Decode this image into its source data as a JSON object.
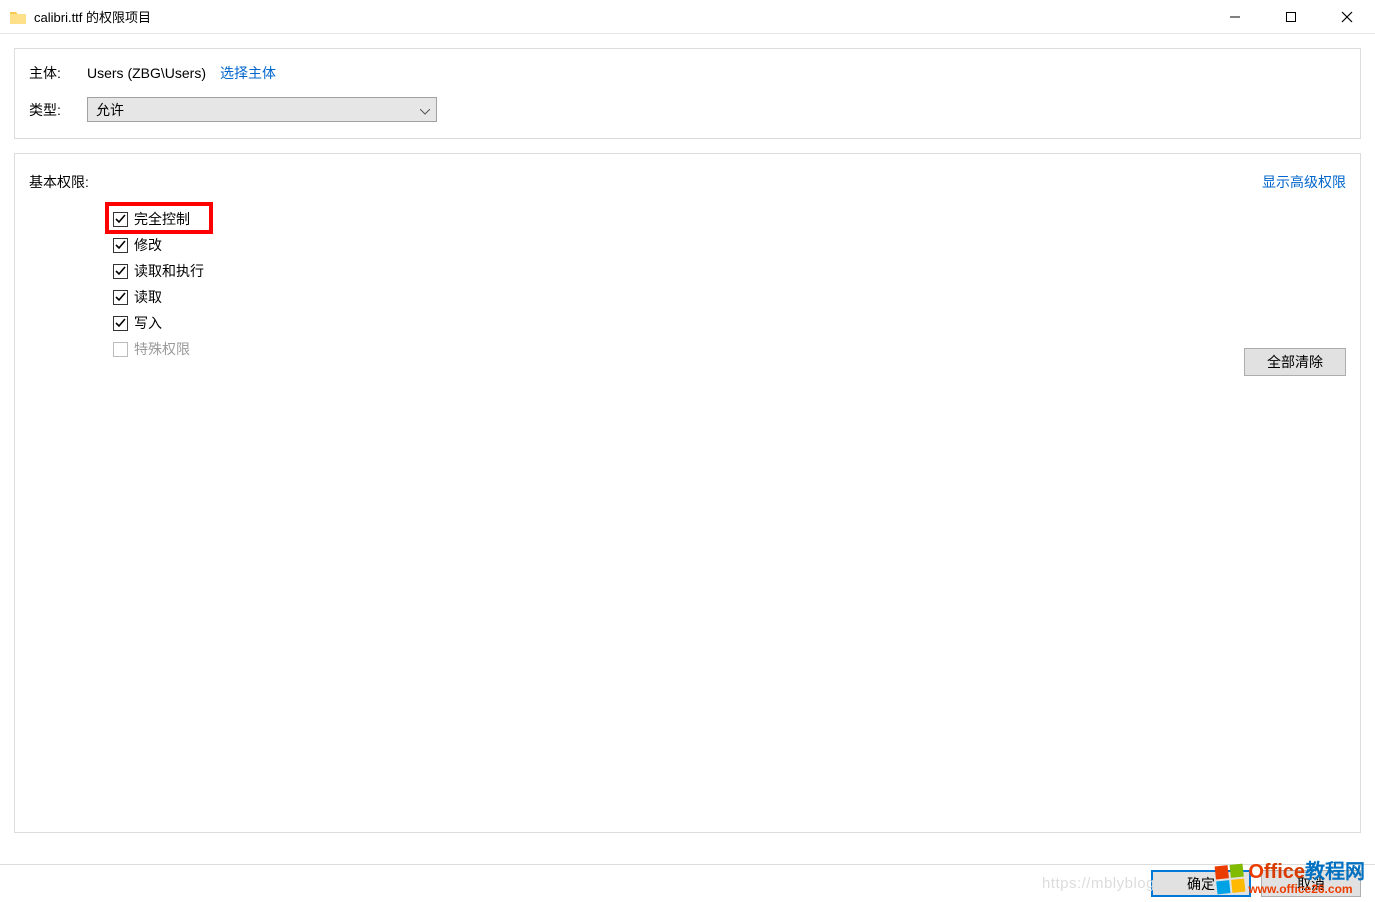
{
  "title": "calibri.ttf 的权限项目",
  "principal": {
    "label": "主体:",
    "value": "Users (ZBG\\Users)",
    "select_link": "选择主体"
  },
  "type": {
    "label": "类型:",
    "selected": "允许"
  },
  "permissions": {
    "section_label": "基本权限:",
    "advanced_link": "显示高级权限",
    "items": [
      {
        "label": "完全控制",
        "checked": true,
        "disabled": false,
        "highlight": true
      },
      {
        "label": "修改",
        "checked": true,
        "disabled": false,
        "highlight": false
      },
      {
        "label": "读取和执行",
        "checked": true,
        "disabled": false,
        "highlight": false
      },
      {
        "label": "读取",
        "checked": true,
        "disabled": false,
        "highlight": false
      },
      {
        "label": "写入",
        "checked": true,
        "disabled": false,
        "highlight": false
      },
      {
        "label": "特殊权限",
        "checked": false,
        "disabled": true,
        "highlight": false
      }
    ],
    "clear_all": "全部清除"
  },
  "footer": {
    "ok": "确定",
    "cancel": "取消"
  },
  "watermark": {
    "line1": "Office教程网",
    "line2": "www.office26.com"
  },
  "ghost_url": "https://mblyblog"
}
